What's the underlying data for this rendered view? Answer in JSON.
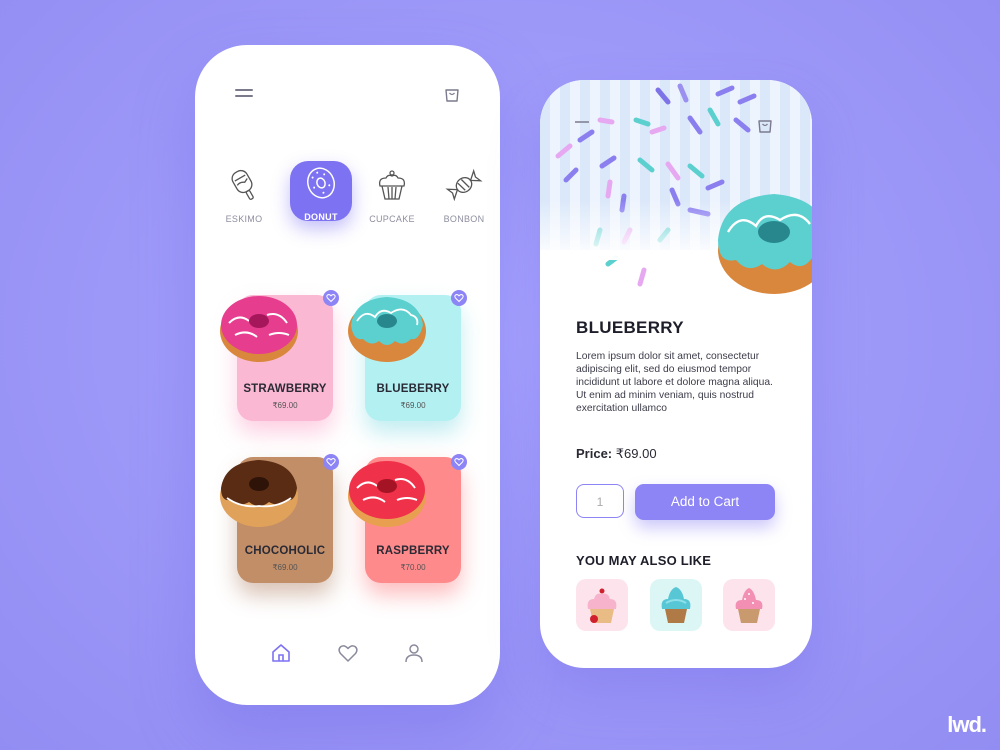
{
  "colors": {
    "accent": "#7d72f2",
    "background": "#a09cf8",
    "strawberry_card": "#fbb8d3",
    "blueberry_card": "#b3f0f2",
    "chocoholic_card": "#c28e68",
    "raspberry_card": "#ff8a8c"
  },
  "left_screen": {
    "categories": [
      {
        "label": "ESKIMO",
        "icon": "ice-cream-bar-icon",
        "active": false
      },
      {
        "label": "DONUT",
        "icon": "donut-icon",
        "active": true
      },
      {
        "label": "CUPCAKE",
        "icon": "cupcake-icon",
        "active": false
      },
      {
        "label": "BONBON",
        "icon": "candy-icon",
        "active": false
      }
    ],
    "products": [
      {
        "name": "STRAWBERRY",
        "price": "₹69.00"
      },
      {
        "name": "BLUEBERRY",
        "price": "₹69.00"
      },
      {
        "name": "CHOCOHOLIC",
        "price": "₹69.00"
      },
      {
        "name": "RASPBERRY",
        "price": "₹70.00"
      }
    ],
    "nav": [
      {
        "icon": "home-icon",
        "active": true
      },
      {
        "icon": "heart-icon",
        "active": false
      },
      {
        "icon": "user-icon",
        "active": false
      }
    ]
  },
  "right_screen": {
    "title": "BLUEBERRY",
    "description": "Lorem ipsum dolor sit amet, consectetur adipiscing elit, sed do eiusmod tempor incididunt ut labore et dolore magna aliqua. Ut enim ad minim veniam, quis nostrud exercitation ullamco",
    "price_label": "Price:",
    "price_value": "₹69.00",
    "quantity": "1",
    "add_to_cart_label": "Add to Cart",
    "also_like_title": "YOU MAY ALSO LIKE"
  },
  "brand": "lwd."
}
